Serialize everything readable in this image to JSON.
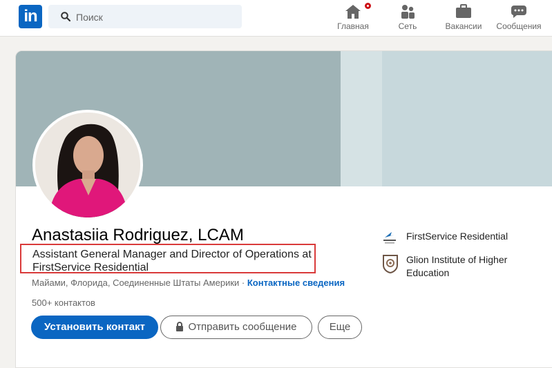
{
  "nav": {
    "logo_text": "in",
    "search_placeholder": "Поиск",
    "items": [
      {
        "label": "Главная",
        "icon": "home-icon"
      },
      {
        "label": "Сеть",
        "icon": "network-icon"
      },
      {
        "label": "Вакансии",
        "icon": "jobs-icon"
      },
      {
        "label": "Сообщения",
        "icon": "messaging-icon"
      }
    ]
  },
  "profile": {
    "name": "Anastasiia Rodriguez, LCAM",
    "headline": "Assistant General Manager and Director of Operations at FirstService Residential",
    "location": "Майами, Флорида, Соединенные Штаты Америки",
    "location_separator": " · ",
    "contact_info_link": "Контактные сведения",
    "connections": "500+ контактов",
    "buttons": {
      "connect": "Установить контакт",
      "message": "Отправить сообщение",
      "more": "Еще"
    },
    "experience": [
      {
        "name": "FirstService Residential",
        "icon": "firstservice-logo-icon"
      },
      {
        "name": "Glion Institute of Higher Education",
        "icon": "glion-logo-icon"
      }
    ]
  },
  "colors": {
    "brand": "#0a66c2",
    "highlight_box": "#d93a3a",
    "notification": "#cc1016"
  }
}
